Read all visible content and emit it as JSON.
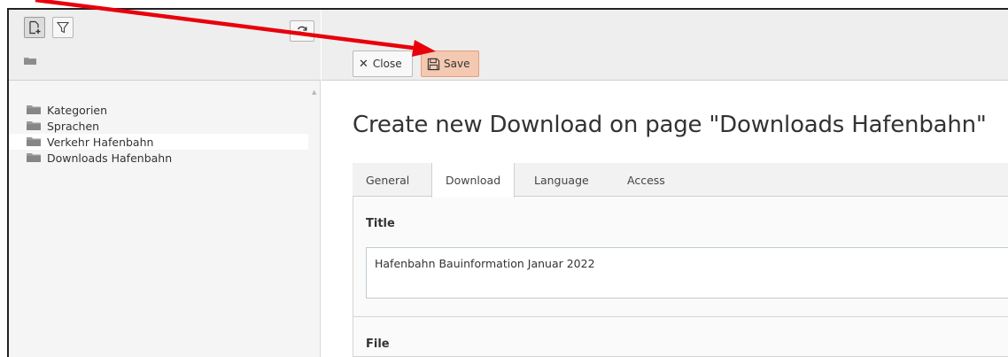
{
  "tree_toolbar": {
    "new_page_icon": "new-page-icon",
    "filter_icon": "filter-icon",
    "refresh_icon": "refresh-icon",
    "root_icon": "folder-icon"
  },
  "tree": {
    "items": [
      {
        "label": "Kategorien",
        "selected": false
      },
      {
        "label": "Sprachen",
        "selected": false
      },
      {
        "label": "Verkehr Hafenbahn",
        "selected": true
      },
      {
        "label": "Downloads Hafenbahn",
        "selected": false
      }
    ]
  },
  "doc_toolbar": {
    "close_label": "Close",
    "close_icon": "close-icon",
    "save_label": "Save",
    "save_icon": "save-icon"
  },
  "page_title": "Create new Download on page \"Downloads Hafenbahn\"",
  "tabs": [
    {
      "label": "General",
      "active": false
    },
    {
      "label": "Download",
      "active": true
    },
    {
      "label": "Language",
      "active": false
    },
    {
      "label": "Access",
      "active": false
    }
  ],
  "form": {
    "title_label": "Title",
    "title_value": "Hafenbahn Bauinformation Januar 2022",
    "file_label": "File"
  },
  "colors": {
    "save_highlight": "#f4c8b1",
    "annotation_arrow": "#e8000b"
  }
}
